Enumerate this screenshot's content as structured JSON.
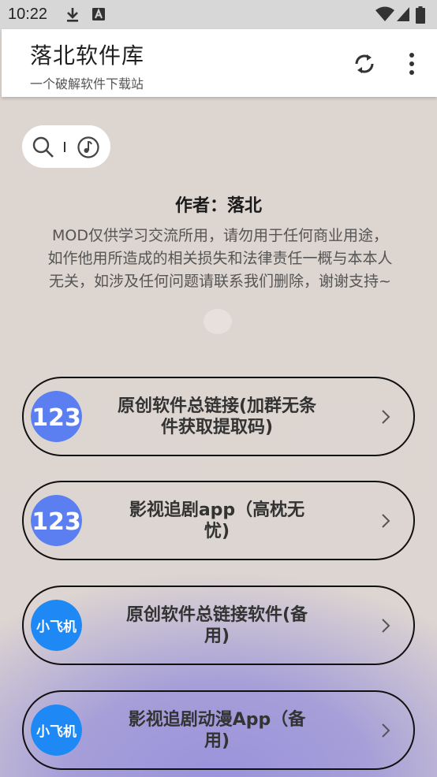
{
  "status_bar": {
    "time": "10:22",
    "icons": [
      "download-icon",
      "notification-a-icon",
      "wifi-icon",
      "signal-icon",
      "battery-icon"
    ]
  },
  "app_bar": {
    "title": "落北软件库",
    "subtitle": "一个破解软件下载站",
    "actions": [
      "refresh-icon",
      "more-vert-icon"
    ]
  },
  "search_pill": {
    "left_icon": "search-icon",
    "right_icon": "music-note-icon"
  },
  "author": "作者：落北",
  "disclaimer": {
    "line1": "MOD仅供学习交流所用，请勿用于任何商业用途，",
    "line2": "如作他用所造成的相关损失和法律责任一概与本本人",
    "line3": "无关，如涉及任何问题请联系我们删除，谢谢支持~"
  },
  "links": [
    {
      "icon": "123-pan-icon",
      "icon_text": "123",
      "line1": "原创软件总链接(加群无条",
      "line2": "件获取提取码)"
    },
    {
      "icon": "123-pan-icon",
      "icon_text": "123",
      "line1": "影视追剧app（高枕无",
      "line2": "忧)"
    },
    {
      "icon": "xiaofeiji-icon",
      "icon_text": "小飞机",
      "line1": "原创软件总链接软件(备",
      "line2": "用)"
    },
    {
      "icon": "xiaofeiji-icon",
      "icon_text": "小飞机",
      "line1": "影视追剧动漫App（备",
      "line2": "用)"
    }
  ],
  "colors": {
    "pan123_blue": "#5b7ff0",
    "xiaofeiji_blue": "#1e88f5",
    "background": "#ded6d1",
    "bottom_glow": "#9b93dc"
  }
}
